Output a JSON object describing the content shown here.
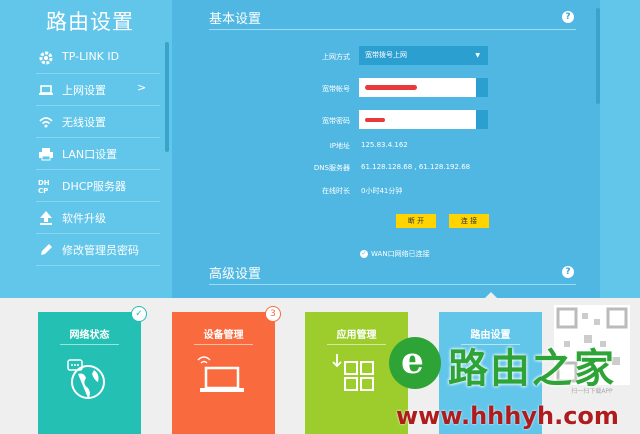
{
  "sidebar": {
    "title": "路由设置",
    "items": [
      {
        "label": "TP-LINK ID",
        "icon": "gear-icon"
      },
      {
        "label": "上网设置",
        "icon": "laptop-icon",
        "arrow": ">"
      },
      {
        "label": "无线设置",
        "icon": "wifi-icon"
      },
      {
        "label": "LAN口设置",
        "icon": "printer-icon"
      },
      {
        "label": "DHCP服务器",
        "icon": "dhcp-icon"
      },
      {
        "label": "软件升级",
        "icon": "upload-icon"
      },
      {
        "label": "修改管理员密码",
        "icon": "pencil-icon"
      }
    ]
  },
  "basic": {
    "title": "基本设置",
    "help": "?",
    "conn_type_label": "上网方式",
    "conn_type_value": "宽带拨号上网",
    "account_label": "宽带帐号",
    "password_label": "宽带密码",
    "ip_label": "IP地址",
    "ip_value": "125.83.4.162",
    "dns_label": "DNS服务器",
    "dns_value": "61.128.128.68 , 61.128.192.68",
    "uptime_label": "在线时长",
    "uptime_value": "0小时41分钟",
    "disconnect_label": "断 开",
    "connect_label": "连 接",
    "status_text": "WAN口网络已连接"
  },
  "advanced": {
    "title": "高级设置",
    "help": "?"
  },
  "tiles": [
    {
      "label": "网络状态",
      "color": "#23c0b3",
      "badge": "✓"
    },
    {
      "label": "设备管理",
      "color": "#f96a3e",
      "badge": "3"
    },
    {
      "label": "应用管理",
      "color": "#9ccd2c"
    },
    {
      "label": "路由设置",
      "color": "#62c6eb"
    }
  ],
  "watermark": {
    "logo_letter": "e",
    "brand": "路由之家",
    "url": "www.hhhyh.com",
    "qr_caption": "扫一扫下载APP"
  },
  "colors": {
    "sidebar_bg": "#62c6eb",
    "panel_bg": "#4fb7e2",
    "button_yellow": "#ffd400",
    "account_scribble": "#e83a3a"
  }
}
